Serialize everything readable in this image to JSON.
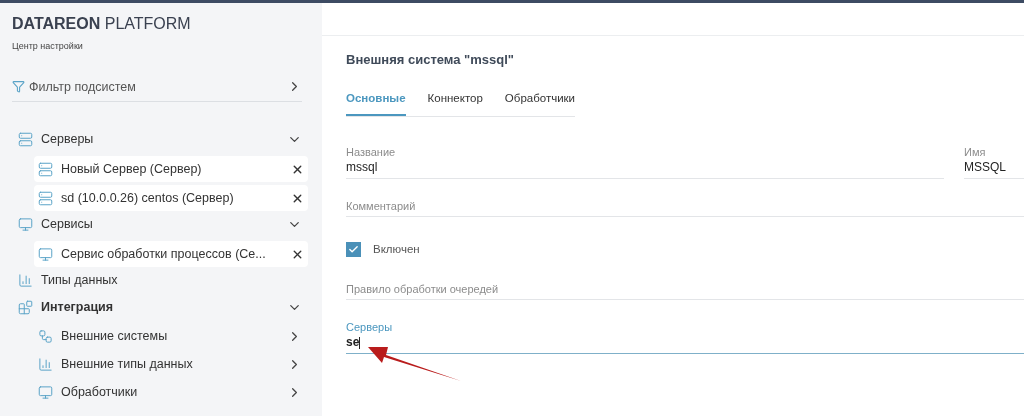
{
  "brand": {
    "name_bold": "DATAREON",
    "name_light": "PLATFORM",
    "subtitle": "Центр настройки"
  },
  "filter": {
    "label": "Фильтр подсистем"
  },
  "tree": [
    {
      "label": "Серверы",
      "kind": "group",
      "expanded": true,
      "active": false,
      "children": [
        {
          "label": "Новый Сервер (Сервер)",
          "kind": "open"
        },
        {
          "label": "sd (10.0.0.26) centos (Сервер)",
          "kind": "open"
        }
      ]
    },
    {
      "label": "Сервисы",
      "kind": "group",
      "expanded": true,
      "active": false,
      "children": [
        {
          "label": "Сервис обработки процессов (Се...",
          "kind": "open"
        }
      ]
    },
    {
      "label": "Типы данных",
      "kind": "leaf",
      "active": false
    },
    {
      "label": "Интеграция",
      "kind": "group",
      "expanded": true,
      "active": true,
      "children": [
        {
          "label": "Внешние системы",
          "kind": "link"
        },
        {
          "label": "Внешние типы данных",
          "kind": "link"
        },
        {
          "label": "Обработчики",
          "kind": "link"
        }
      ]
    }
  ],
  "main": {
    "title": "Внешняя система \"mssql\"",
    "tabs": [
      {
        "label": "Основные",
        "selected": true
      },
      {
        "label": "Коннектор",
        "selected": false
      },
      {
        "label": "Обработчики",
        "selected": false
      }
    ],
    "fields": [
      {
        "kind": "pair",
        "items": [
          {
            "label": "Название",
            "value": "mssql",
            "focused": false
          },
          {
            "label": "Имя",
            "value": "MSSQL",
            "focused": false
          }
        ]
      },
      {
        "kind": "text",
        "label": "Комментарий",
        "focused": false
      },
      {
        "kind": "checkbox",
        "label": "Включен",
        "checked": true
      },
      {
        "kind": "text",
        "label": "Правило обработки очередей",
        "focused": false
      },
      {
        "kind": "text",
        "label": "Серверы",
        "value": "se",
        "focused": true
      }
    ]
  }
}
